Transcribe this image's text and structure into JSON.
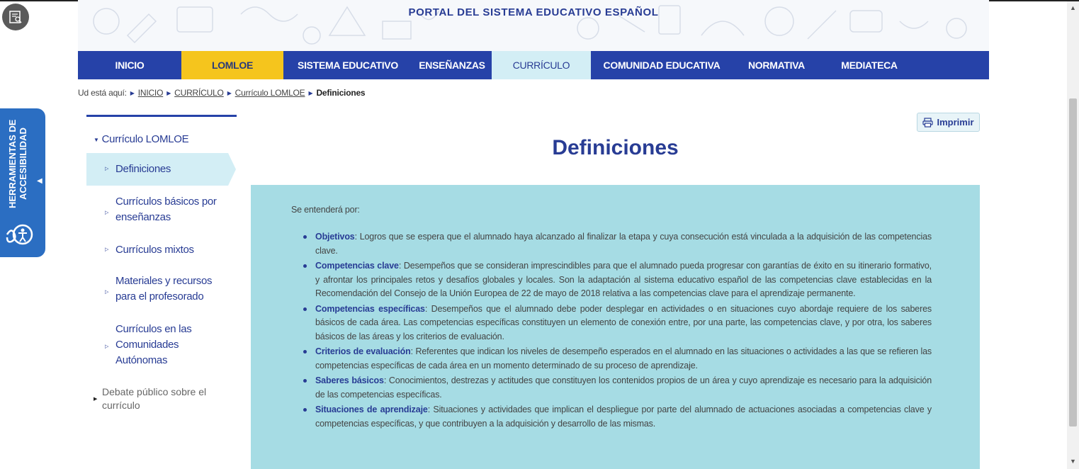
{
  "header": {
    "portal_title": "PORTAL DEL SISTEMA EDUCATIVO ESPAÑOL"
  },
  "nav": {
    "items": [
      {
        "label": "INICIO"
      },
      {
        "label": "LOMLOE"
      },
      {
        "label": "SISTEMA EDUCATIVO"
      },
      {
        "label": "ENSEÑANZAS"
      },
      {
        "label": "CURRÍCULO"
      },
      {
        "label": "COMUNIDAD EDUCATIVA"
      },
      {
        "label": "NORMATIVA"
      },
      {
        "label": "MEDIATECA"
      }
    ]
  },
  "breadcrumb": {
    "prefix": "Ud está aquí:",
    "items": [
      "INICIO",
      "CURRÍCULO",
      "Currículo LOMLOE"
    ],
    "current": "Definiciones"
  },
  "accessibility": {
    "label": "HERRAMIENTAS DE ACCESIBILIDAD",
    "icon": "accessibility-icon"
  },
  "sidebar": {
    "parent": "Currículo LOMLOE",
    "items": [
      {
        "label": "Definiciones"
      },
      {
        "label": "Currículos básicos por enseñanzas"
      },
      {
        "label": "Currículos mixtos"
      },
      {
        "label": "Materiales y recursos para el profesorado"
      },
      {
        "label": "Currículos en las Comunidades Autónomas"
      }
    ],
    "debate": "Debate público sobre el currículo"
  },
  "print": {
    "label": "Imprimir",
    "icon": "printer-icon"
  },
  "page": {
    "title": "Definiciones",
    "intro": "Se entenderá por:",
    "definitions": [
      {
        "term": "Objetivos",
        "text": ": Logros que se espera que el alumnado haya alcanzado al finalizar la etapa y cuya consecución está vinculada a la adquisición de las competencias clave."
      },
      {
        "term": "Competencias clave",
        "text": ": Desempeños que se consideran imprescindibles para que el alumnado pueda progresar con garantías de éxito en su itinerario formativo, y afrontar los principales retos y desafíos globales y locales. Son la adaptación al sistema educativo español de las competencias clave establecidas en la Recomendación del Consejo de la Unión Europea de 22 de mayo de 2018 relativa a las competencias clave para el aprendizaje permanente."
      },
      {
        "term": "Competencias específicas",
        "text": ": Desempeños que el alumnado debe poder desplegar en actividades o en situaciones cuyo abordaje requiere de los saberes básicos de cada área. Las competencias específicas constituyen un elemento de conexión entre, por una parte, las competencias clave, y por otra, los saberes básicos de las áreas y los criterios de evaluación."
      },
      {
        "term": "Criterios de evaluación",
        "text": ": Referentes que indican los niveles de desempeño esperados en el alumnado en las situaciones o actividades a las que se refieren las competencias específicas de cada área en un momento determinado de su proceso de aprendizaje."
      },
      {
        "term": "Saberes básicos",
        "text": ": Conocimientos, destrezas y actitudes que constituyen los contenidos propios de un área y cuyo aprendizaje es necesario para la adquisición de las competencias específicas."
      },
      {
        "term": "Situaciones de aprendizaje",
        "text": ": Situaciones y actividades que implican el despliegue por parte del alumnado de actuaciones asociadas a competencias clave y competencias específicas, y que contribuyen a la adquisición y desarrollo de las mismas."
      }
    ]
  },
  "colors": {
    "primary_blue": "#2642a8",
    "lomloe_yellow": "#f5c51d",
    "active_tab": "#d3eef5",
    "content_bg": "#a6dce4",
    "access_blue": "#2b6ec2"
  }
}
